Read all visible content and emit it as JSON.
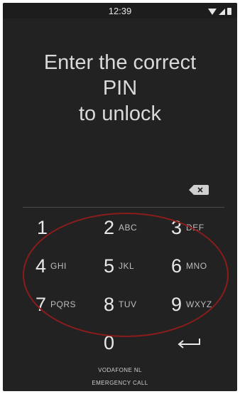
{
  "status_bar": {
    "time": "12:39",
    "icons": [
      "wifi-icon",
      "signal-icon",
      "battery-icon"
    ]
  },
  "prompt": {
    "line1": "Enter the correct",
    "line2": "PIN",
    "line3": "to unlock"
  },
  "keypad": {
    "keys": [
      {
        "digit": "1",
        "letters": ""
      },
      {
        "digit": "2",
        "letters": "ABC"
      },
      {
        "digit": "3",
        "letters": "DEF"
      },
      {
        "digit": "4",
        "letters": "GHI"
      },
      {
        "digit": "5",
        "letters": "JKL"
      },
      {
        "digit": "6",
        "letters": "MNO"
      },
      {
        "digit": "7",
        "letters": "PQRS"
      },
      {
        "digit": "8",
        "letters": "TUV"
      },
      {
        "digit": "9",
        "letters": "WXYZ"
      },
      {
        "digit": "0",
        "letters": ""
      }
    ],
    "backspace_icon": "backspace-icon",
    "enter_icon": "enter-arrow-icon"
  },
  "footer": {
    "carrier": "VODAFONE NL",
    "emergency": "EMERGENCY CALL"
  },
  "colors": {
    "background": "#222222",
    "text": "#e8e8e8",
    "annotation": "#8b1c1c"
  }
}
